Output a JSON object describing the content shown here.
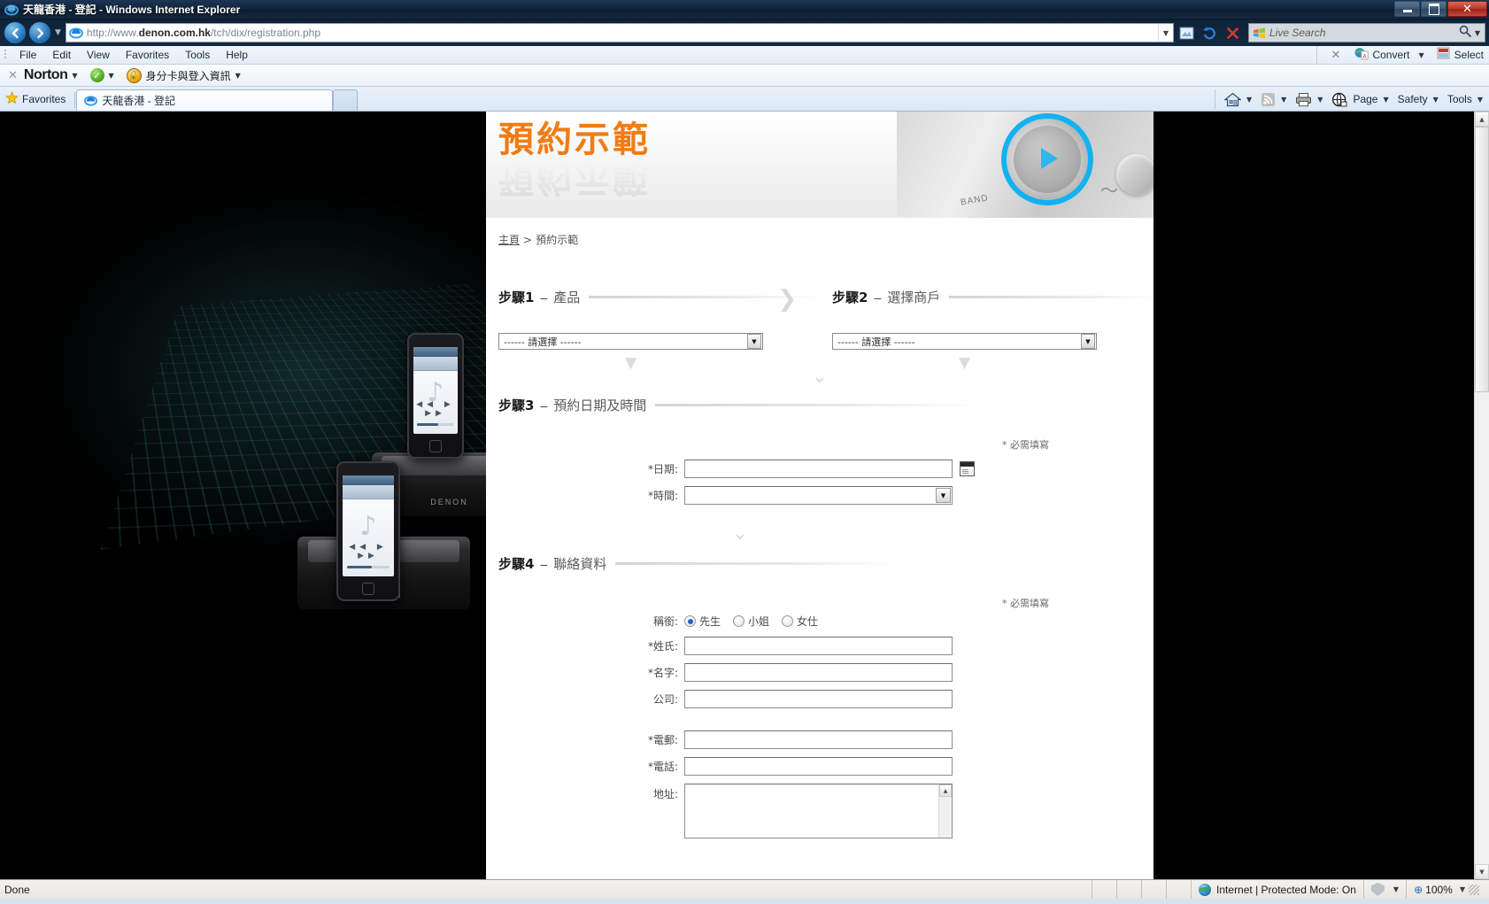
{
  "window": {
    "title": "天龍香港 - 登記 - Windows Internet Explorer",
    "minimize_label": "Minimize",
    "maximize_label": "Maximize",
    "close_label": "✕"
  },
  "nav": {
    "back_label": "◀",
    "forward_label": "▶",
    "history_caret": "▼",
    "url_prefix": "http://www.",
    "url_domain": "denon.com.hk",
    "url_suffix": "/tch/dix/registration.php",
    "url_full": "http://www.denon.com.hk/tch/dix/registration.php",
    "address_dropdown": "▼",
    "compat_icon": "compatibility-view-icon",
    "refresh_icon": "refresh-icon",
    "stop_icon": "✕",
    "search_placeholder": "Live Search",
    "search_go": "search-icon",
    "search_caret": "▼"
  },
  "menubar": {
    "items": [
      "File",
      "Edit",
      "View",
      "Favorites",
      "Tools",
      "Help"
    ],
    "close_x": "✕",
    "convert_label": "Convert",
    "convert_caret": "▼",
    "select_label": "Select"
  },
  "norton": {
    "close_x": "✕",
    "brand": "Norton",
    "brand_caret": "▼",
    "status_caret": "▼",
    "identity_label": "身分卡與登入資訊",
    "identity_caret": "▼",
    "check_glyph": "✓"
  },
  "tabs": {
    "favorites_label": "Favorites",
    "star_glyph": "★",
    "items": [
      {
        "label": "天龍香港 - 登記",
        "active": true
      }
    ],
    "new_tab_label": "",
    "toolbar": {
      "home_caret": "▼",
      "feeds_caret": "▼",
      "print_caret": "▼",
      "page_label": "Page",
      "page_caret": "▼",
      "safety_label": "Safety",
      "safety_caret": "▼",
      "tools_label": "Tools",
      "tools_caret": "▼"
    }
  },
  "page": {
    "banner_title": "預約示範",
    "breadcrumb": {
      "home": "主頁",
      "separator": ">",
      "current": "預約示範"
    },
    "banner_device_band_label": "BAND",
    "chevron_right": "❯",
    "chevron_down": "⌄",
    "small_chevron": "▼",
    "steps": [
      {
        "number": "步驟1",
        "dash": "–",
        "label": "產品",
        "select_value": "------ 請選擇 ------",
        "select_arrow": "▼"
      },
      {
        "number": "步驟2",
        "dash": "–",
        "label": "選擇商戶",
        "select_value": "------ 請選擇 ------",
        "select_arrow": "▼"
      },
      {
        "number": "步驟3",
        "dash": "–",
        "label": "預約日期及時間"
      },
      {
        "number": "步驟4",
        "dash": "–",
        "label": "聯絡資料"
      }
    ],
    "required_note": "* 必需填寫",
    "step3_fields": [
      {
        "label": "*日期:",
        "value": "",
        "type": "text",
        "has_calendar": true
      },
      {
        "label": "*時間:",
        "value": "",
        "type": "select",
        "arrow": "▼"
      }
    ],
    "step4": {
      "title_label": "稱銜:",
      "title_options": [
        {
          "label": "先生",
          "selected": true
        },
        {
          "label": "小姐",
          "selected": false
        },
        {
          "label": "女仕",
          "selected": false
        }
      ],
      "fields": [
        {
          "label": "*姓氏:",
          "value": "",
          "type": "text"
        },
        {
          "label": "*名字:",
          "value": "",
          "type": "text"
        },
        {
          "label": "公司:",
          "value": "",
          "type": "text"
        },
        {
          "label": "*電郵:",
          "value": "",
          "type": "text"
        },
        {
          "label": "*電話:",
          "value": "",
          "type": "text"
        },
        {
          "label": "地址:",
          "value": "",
          "type": "textarea"
        }
      ]
    },
    "product_photo": {
      "brand": "DENON",
      "music_note": "♪",
      "transport_controls": "◀◀ ▶ ▶▶"
    }
  },
  "statusbar": {
    "status_text": "Done",
    "zone_text": "Internet | Protected Mode: On",
    "zone_caret": "▼",
    "zoom_level": "100%",
    "zoom_glyph": "⊕",
    "zoom_caret": "▼"
  },
  "colors": {
    "accent_orange": "#f07c14",
    "accent_blue": "#12b2f0",
    "radio_blue": "#1d63c4",
    "chrome_blue": "#e4edf7"
  }
}
